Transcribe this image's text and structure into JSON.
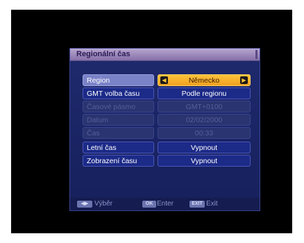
{
  "window": {
    "title": "Regionální čas"
  },
  "rows": [
    {
      "label": "Region",
      "value": "Německo",
      "state": "selected"
    },
    {
      "label": "GMT volba času",
      "value": "Podle regionu",
      "state": "normal"
    },
    {
      "label": "Časové pásmo",
      "value": "GMT+0100",
      "state": "disabled"
    },
    {
      "label": "Datum",
      "value": "02/02/2000",
      "state": "disabled"
    },
    {
      "label": "Čas",
      "value": "00:33",
      "state": "disabled"
    },
    {
      "label": "Letní čas",
      "value": "Vypnout",
      "state": "normal"
    },
    {
      "label": "Zobrazení času",
      "value": "Vypnout",
      "state": "normal"
    }
  ],
  "footer": {
    "select": {
      "key": "◀▶",
      "label": "Výběr"
    },
    "enter": {
      "key": "OK",
      "label": "Enter"
    },
    "exit": {
      "key": "EXIT",
      "label": "Exit"
    }
  },
  "colors": {
    "highlight": "#f0a020",
    "panel": "#1c2a88",
    "title_bar": "#8470a8"
  },
  "icons": {
    "arrow_left": "chevron-left-icon",
    "arrow_right": "chevron-right-icon"
  }
}
